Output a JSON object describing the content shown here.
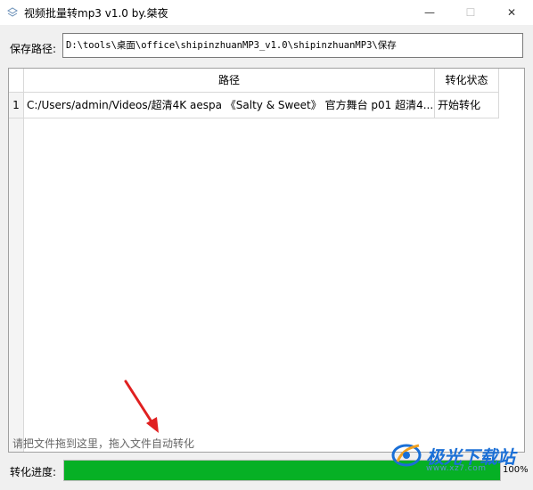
{
  "window": {
    "title": "视频批量转mp3 v1.0   by.桀夜",
    "min_glyph": "—",
    "max_glyph": "☐",
    "close_glyph": "✕",
    "app_icon": "app-icon"
  },
  "save": {
    "label": "保存路径:",
    "value": "D:\\tools\\桌面\\office\\shipinzhuanMP3_v1.0\\shipinzhuanMP3\\保存"
  },
  "table": {
    "columns": [
      "路径",
      "转化状态"
    ],
    "rows": [
      {
        "index": "1",
        "path": "C:/Users/admin/Videos/超清4K aespa 《Salty & Sweet》 官方舞台 p01 超清4...",
        "status": "开始转化"
      }
    ],
    "hint": "请把文件拖到这里，拖入文件自动转化"
  },
  "progress": {
    "label": "转化进度:",
    "value": 1.0,
    "percent_text": "100%",
    "color": "#06b025"
  },
  "watermark": {
    "text": "极光下载站",
    "sub": "www.xz7.com"
  },
  "annotation": {
    "arrow_color": "#e02020"
  }
}
